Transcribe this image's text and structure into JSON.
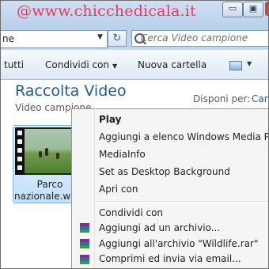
{
  "watermark": "@www.chicchedicala.it",
  "window_controls": {
    "minimize": "▭",
    "maximize": "▣"
  },
  "address": {
    "value": "ne",
    "refresh_glyph": "↻"
  },
  "search": {
    "placeholder": "Cerca Video campione"
  },
  "toolbar": {
    "all_label": "tutti",
    "share_label": "Condividi con",
    "new_folder_label": "Nuova cartella"
  },
  "library": {
    "title": "Raccolta Video",
    "subtitle": "Video campione",
    "arrange_label": "Disponi per:",
    "arrange_value": "Car"
  },
  "file": {
    "name_line1": "Parco",
    "name_line2": "nazionale.wmv"
  },
  "context_menu": {
    "items": [
      {
        "label": "Play",
        "bold": true
      },
      {
        "label": "Aggiungi a elenco Windows Media Player"
      },
      {
        "label": "MediaInfo"
      },
      {
        "label": "Set as Desktop Background"
      },
      {
        "label": "Apri con"
      },
      {
        "label": "Condividi con"
      },
      {
        "label": "Aggiungi ad un archivio...",
        "icon": "winrar-icon"
      },
      {
        "label": "Aggiungi all'archivio \"Wildlife.rar\"",
        "icon": "winrar-icon"
      },
      {
        "label": "Comprimi ed invia via email...",
        "icon": "winrar-icon"
      }
    ]
  },
  "colors": {
    "title_blue": "#1e5a9a",
    "watermark_pink": "#e8395a",
    "selection_blue": "#c4e1f8"
  }
}
